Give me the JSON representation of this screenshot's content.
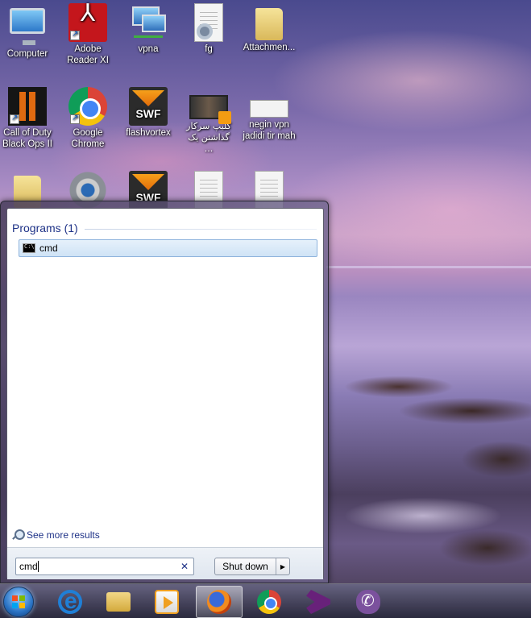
{
  "desktop": {
    "icons": [
      {
        "label": "Computer",
        "icon": "computer-icon"
      },
      {
        "label": "Adobe Reader XI",
        "icon": "adobe-reader-icon"
      },
      {
        "label": "vpna",
        "icon": "network-icon"
      },
      {
        "label": "fg",
        "icon": "config-file-icon"
      },
      {
        "label": "Attachmen...",
        "icon": "folder-icon"
      },
      {
        "label": "Call of Duty Black Ops II",
        "icon": "game-icon"
      },
      {
        "label": "Google Chrome",
        "icon": "chrome-icon"
      },
      {
        "label": "flashvortex",
        "icon": "swf-icon"
      },
      {
        "label": "کلیپ سرکار گذاشتن یک ...",
        "icon": "video-file-icon"
      },
      {
        "label": "negin vpn jadidi tir mah",
        "icon": "document-icon"
      },
      {
        "label": "",
        "icon": "folder-icon"
      },
      {
        "label": "",
        "icon": "camera-icon"
      },
      {
        "label": "",
        "icon": "swf-icon"
      },
      {
        "label": "",
        "icon": "text-file-icon"
      },
      {
        "label": "",
        "icon": "text-file-icon"
      }
    ]
  },
  "start_menu": {
    "group_header": "Programs (1)",
    "results": [
      {
        "label": "cmd",
        "icon": "cmd-icon",
        "selected": true
      }
    ],
    "see_more": "See more results",
    "search": {
      "value": "cmd"
    },
    "shutdown_label": "Shut down"
  },
  "taskbar": {
    "items": [
      {
        "name": "start-orb",
        "icon": "windows-logo-icon"
      },
      {
        "name": "internet-explorer",
        "icon": "ie-icon"
      },
      {
        "name": "windows-explorer",
        "icon": "explorer-icon"
      },
      {
        "name": "media-player",
        "icon": "media-player-icon"
      },
      {
        "name": "firefox",
        "icon": "firefox-icon",
        "active": true
      },
      {
        "name": "chrome",
        "icon": "chrome-icon"
      },
      {
        "name": "visual-studio",
        "icon": "visual-studio-icon"
      },
      {
        "name": "viber",
        "icon": "viber-icon"
      }
    ]
  }
}
